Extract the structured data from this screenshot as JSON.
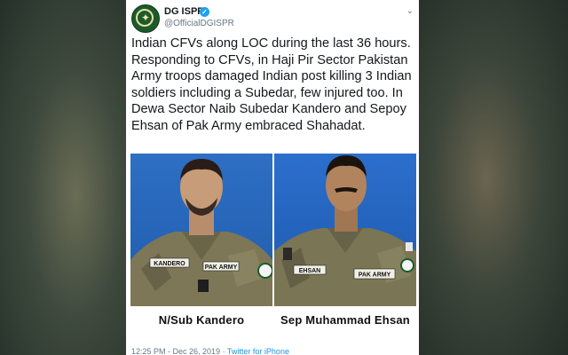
{
  "account": {
    "name": "DG ISPR",
    "handle": "@OfficialDGISPR"
  },
  "tweet": {
    "text": "Indian CFVs along LOC during the last 36 hours. Responding to CFVs, in Haji Pir Sector Pakistan Army troops damaged Indian post killing 3 Indian soldiers including a Subedar, few injured too. In Dewa Sector Naib Subedar Kandero and Sepoy Ehsan of Pak Army embraced Shahadat.",
    "timestamp": "12:25 PM - Dec 26, 2019",
    "source": "Twitter for iPhone"
  },
  "photos": [
    {
      "caption": "N/Sub Kandero",
      "name_tag": "KANDERO",
      "unit_tag": "PAK ARMY"
    },
    {
      "caption": "Sep Muhammad Ehsan",
      "name_tag": "EHSAN",
      "unit_tag": "PAK ARMY"
    }
  ],
  "colors": {
    "verified": "#1da1f2",
    "photo_background": "#2e6fc4",
    "uniform": "#7a7555"
  }
}
